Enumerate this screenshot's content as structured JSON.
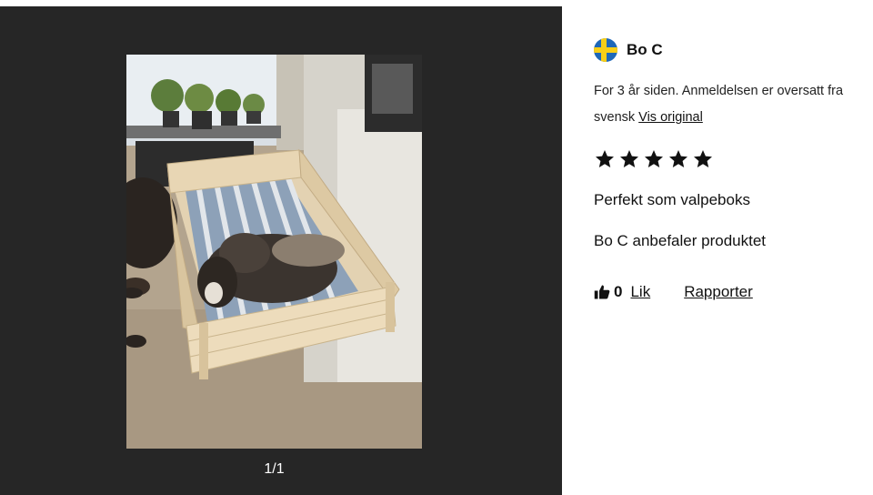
{
  "gallery": {
    "counter": "1/1",
    "image_alt": "Hund som ligger i en valpeboks av tre"
  },
  "review": {
    "author": "Bo C",
    "country_flag": "sweden-flag-icon",
    "time_text": "For 3 år siden. Anmeldelsen er oversatt fra svensk",
    "original_link": "Vis original",
    "rating": 5,
    "rating_max": 5,
    "summary": "Perfekt som valpeboks",
    "recommend": "Bo C anbefaler produktet",
    "likes": "0",
    "like_label": "Lik",
    "report_label": "Rapporter"
  },
  "colors": {
    "gallery_bg": "#262626",
    "star": "#111111"
  }
}
